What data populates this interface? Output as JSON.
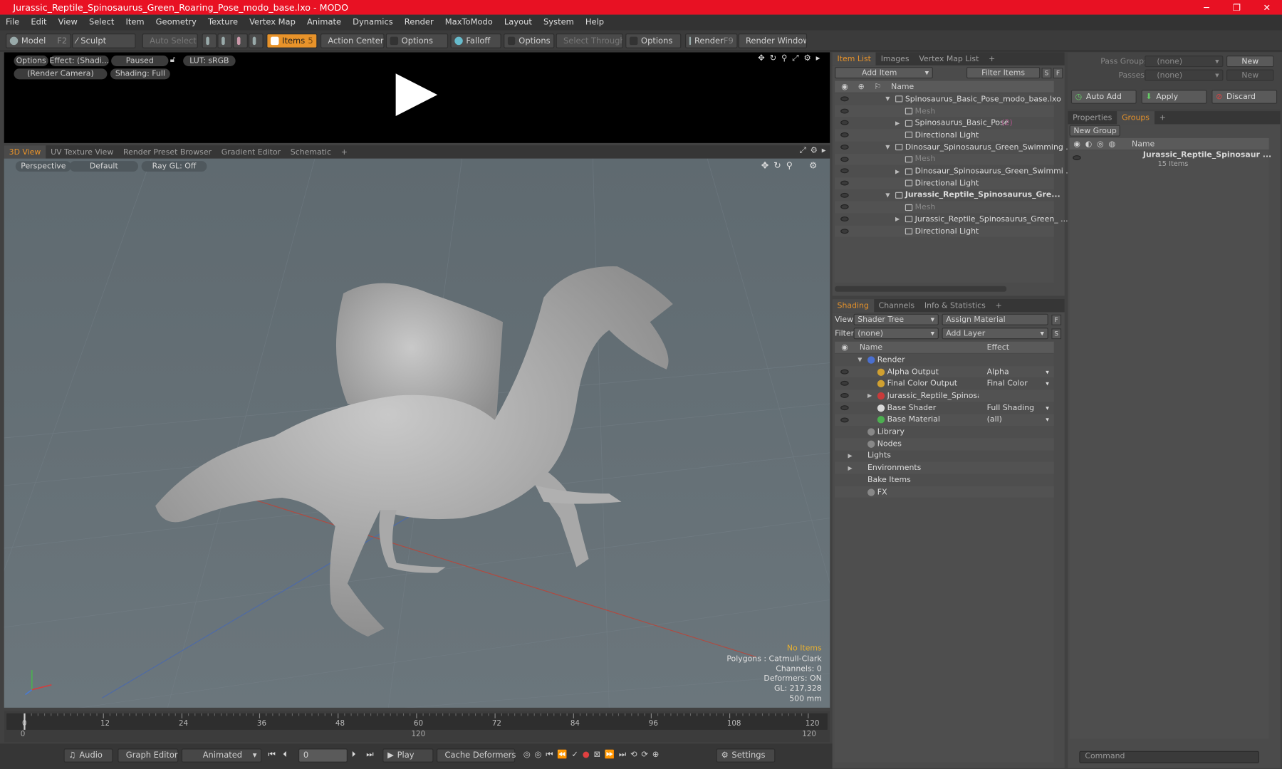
{
  "window": {
    "title": "Jurassic_Reptile_Spinosaurus_Green_Roaring_Pose_modo_base.lxo - MODO",
    "min": "─",
    "max": "❐",
    "close": "✕"
  },
  "menu": [
    "File",
    "Edit",
    "View",
    "Select",
    "Item",
    "Geometry",
    "Texture",
    "Vertex Map",
    "Animate",
    "Dynamics",
    "Render",
    "MaxToModo",
    "Layout",
    "System",
    "Help"
  ],
  "toolbar": {
    "model": "Model",
    "model_key": "F2",
    "sculpt": "Sculpt",
    "auto_select": "Auto Select",
    "items": "Items",
    "items_key": "5",
    "action_center": "Action Center",
    "options1": "Options",
    "falloff": "Falloff",
    "options2": "Options",
    "select_through": "Select Through",
    "options3": "Options",
    "render": "Render",
    "render_key": "F9",
    "render_window": "Render Window"
  },
  "preview": {
    "options": "Options",
    "effect": "Effect: (Shadi...",
    "paused": "Paused",
    "lut": "LUT: sRGB",
    "camera": "(Render Camera)",
    "shading": "Shading: Full"
  },
  "view_tabs": [
    "3D View",
    "UV Texture View",
    "Render Preset Browser",
    "Gradient Editor",
    "Schematic",
    "+"
  ],
  "viewport": {
    "perspective": "Perspective",
    "default": "Default",
    "raygl": "Ray GL: Off",
    "stats": [
      "No Items",
      "Polygons : Catmull-Clark",
      "Channels: 0",
      "Deformers: ON",
      "GL: 217,328",
      "500 mm"
    ]
  },
  "timeline": {
    "ticks": [
      "0",
      "12",
      "24",
      "36",
      "48",
      "60",
      "72",
      "84",
      "96",
      "108",
      "120"
    ],
    "start": "0",
    "mid": "120",
    "end": "120"
  },
  "bottom": {
    "audio": "Audio",
    "graph_editor": "Graph Editor",
    "animated": "Animated",
    "frame": "0",
    "play": "Play",
    "cache": "Cache Deformers",
    "settings": "Settings"
  },
  "item_list": {
    "tabs": [
      "Item List",
      "Images",
      "Vertex Map List",
      "+"
    ],
    "add_item": "Add Item",
    "filter": "Filter Items",
    "s": "S",
    "f": "F",
    "col_name": "Name",
    "rows": [
      {
        "label": "Spinosaurus_Basic_Pose_modo_base.lxo",
        "indent": 1,
        "arrow": "▼",
        "bold": false,
        "dim": false
      },
      {
        "label": "Mesh",
        "indent": 2,
        "arrow": "",
        "bold": false,
        "dim": true
      },
      {
        "label": "Spinosaurus_Basic_Pose",
        "extra": "(2)",
        "indent": 2,
        "arrow": "▶",
        "bold": false,
        "dim": false
      },
      {
        "label": "Directional Light",
        "indent": 2,
        "arrow": "",
        "bold": false,
        "dim": false
      },
      {
        "label": "Dinosaur_Spinosaurus_Green_Swimming ...",
        "indent": 1,
        "arrow": "▼",
        "bold": false,
        "dim": false
      },
      {
        "label": "Mesh",
        "indent": 2,
        "arrow": "",
        "bold": false,
        "dim": true
      },
      {
        "label": "Dinosaur_Spinosaurus_Green_Swimmi ...",
        "indent": 2,
        "arrow": "▶",
        "bold": false,
        "dim": false
      },
      {
        "label": "Directional Light",
        "indent": 2,
        "arrow": "",
        "bold": false,
        "dim": false
      },
      {
        "label": "Jurassic_Reptile_Spinosaurus_Gre...",
        "indent": 1,
        "arrow": "▼",
        "bold": true,
        "dim": false
      },
      {
        "label": "Mesh",
        "indent": 2,
        "arrow": "",
        "bold": false,
        "dim": true
      },
      {
        "label": "Jurassic_Reptile_Spinosaurus_Green_ ...",
        "indent": 2,
        "arrow": "▶",
        "bold": false,
        "dim": false
      },
      {
        "label": "Directional Light",
        "indent": 2,
        "arrow": "",
        "bold": false,
        "dim": false
      }
    ]
  },
  "shading": {
    "tabs": [
      "Shading",
      "Channels",
      "Info & Statistics",
      "+"
    ],
    "view_label": "View",
    "view_value": "Shader Tree",
    "assign": "Assign Material",
    "f": "F",
    "filter_label": "Filter",
    "filter_value": "(none)",
    "add_layer": "Add Layer",
    "s": "S",
    "col_name": "Name",
    "col_effect": "Effect",
    "rows": [
      {
        "label": "Render",
        "effect": "",
        "indent": 1,
        "arrow": "▼",
        "eye": false,
        "color": "#4a6fd0"
      },
      {
        "label": "Alpha Output",
        "effect": "Alpha",
        "indent": 2,
        "arrow": "",
        "eye": true,
        "color": "#d0a030"
      },
      {
        "label": "Final Color Output",
        "effect": "Final Color",
        "indent": 2,
        "arrow": "",
        "eye": true,
        "color": "#d0a030"
      },
      {
        "label": "Jurassic_Reptile_Spinosaur...",
        "effect": "",
        "indent": 2,
        "arrow": "▶",
        "eye": true,
        "color": "#c83a3a"
      },
      {
        "label": "Base Shader",
        "effect": "Full Shading",
        "indent": 2,
        "arrow": "",
        "eye": true,
        "color": "#d8d8d8"
      },
      {
        "label": "Base Material",
        "effect": "(all)",
        "indent": 2,
        "arrow": "",
        "eye": true,
        "color": "#4caf50"
      },
      {
        "label": "Library",
        "effect": "",
        "indent": 1,
        "arrow": "",
        "eye": false,
        "color": "#888"
      },
      {
        "label": "Nodes",
        "effect": "",
        "indent": 1,
        "arrow": "",
        "eye": false,
        "color": "#888"
      },
      {
        "label": "Lights",
        "effect": "",
        "indent": 0,
        "arrow": "▶",
        "eye": false,
        "color": ""
      },
      {
        "label": "Environments",
        "effect": "",
        "indent": 0,
        "arrow": "▶",
        "eye": false,
        "color": ""
      },
      {
        "label": "Bake Items",
        "effect": "",
        "indent": 0,
        "arrow": "",
        "eye": false,
        "color": ""
      },
      {
        "label": "FX",
        "effect": "",
        "indent": 1,
        "arrow": "",
        "eye": false,
        "color": "#888"
      }
    ]
  },
  "right": {
    "pass_groups": "Pass Groups",
    "passes": "Passes",
    "none1": "(none)",
    "none2": "(none)",
    "new1": "New",
    "new2": "New",
    "auto_add": "Auto Add",
    "apply": "Apply",
    "discard": "Discard",
    "tabs": [
      "Properties",
      "Groups",
      "+"
    ],
    "new_group": "New Group",
    "col_name": "Name",
    "group_name": "Jurassic_Reptile_Spinosaur ...",
    "group_count": "15 Items",
    "command": "Command"
  }
}
